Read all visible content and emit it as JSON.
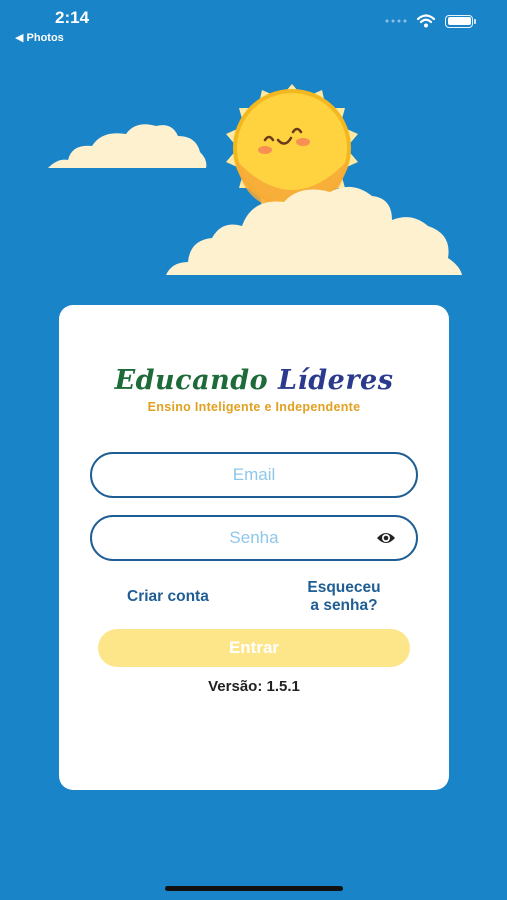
{
  "status_bar": {
    "time": "2:14",
    "back_app": "◀ Photos"
  },
  "logo": {
    "title_word1": "Educando",
    "title_word2": "Líderes",
    "subtitle": "Ensino Inteligente e Independente"
  },
  "form": {
    "email_placeholder": "Email",
    "email_value": "",
    "password_placeholder": "Senha",
    "password_value": "",
    "eye_icon": "eye-icon"
  },
  "links": {
    "create_account": "Criar conta",
    "forgot_password_line1": "Esqueceu",
    "forgot_password_line2": "a senha?"
  },
  "login_button": "Entrar",
  "version": "Versão: 1.5.1",
  "colors": {
    "background": "#1a84c8",
    "accent": "#1f5e94",
    "button": "#fde68a",
    "sun": "#ffd23f"
  }
}
